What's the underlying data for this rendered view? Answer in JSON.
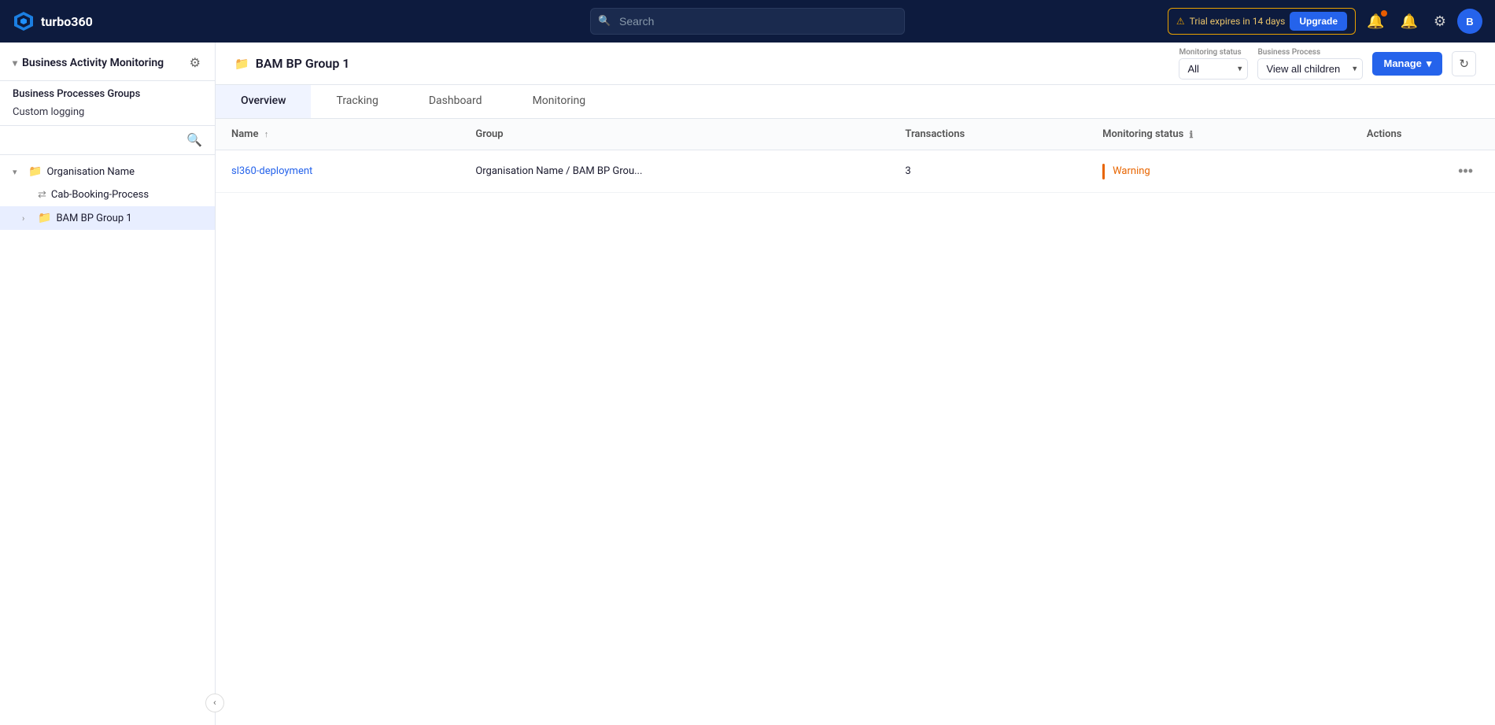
{
  "brand": {
    "name": "turbo360"
  },
  "topnav": {
    "search_placeholder": "Search",
    "trial_text": "Trial expires in 14 days",
    "upgrade_label": "Upgrade",
    "avatar_label": "B"
  },
  "sidebar": {
    "title": "Business Activity Monitoring",
    "section_items": [
      {
        "label": "Business Processes Groups",
        "active": true
      },
      {
        "label": "Custom logging",
        "active": false
      }
    ],
    "tree": [
      {
        "label": "Organisation Name",
        "level": 0,
        "type": "org",
        "expanded": true
      },
      {
        "label": "Cab-Booking-Process",
        "level": 1,
        "type": "process"
      },
      {
        "label": "BAM BP Group 1",
        "level": 1,
        "type": "folder",
        "expanded": true,
        "active": true
      }
    ]
  },
  "page": {
    "title": "BAM BP Group 1",
    "monitoring_status_label": "Monitoring status",
    "monitoring_status_value": "All",
    "business_process_label": "Business Process",
    "business_process_value": "View all children",
    "manage_label": "Manage"
  },
  "tabs": [
    {
      "label": "Overview",
      "active": true
    },
    {
      "label": "Tracking",
      "active": false
    },
    {
      "label": "Dashboard",
      "active": false
    },
    {
      "label": "Monitoring",
      "active": false
    }
  ],
  "table": {
    "columns": [
      {
        "label": "Name",
        "sortable": true
      },
      {
        "label": "Group",
        "sortable": false
      },
      {
        "label": "Transactions",
        "sortable": false
      },
      {
        "label": "Monitoring status",
        "info": true
      },
      {
        "label": "Actions",
        "sortable": false
      }
    ],
    "rows": [
      {
        "name": "sl360-deployment",
        "group": "Organisation Name / BAM BP Grou...",
        "transactions": "3",
        "monitoring_status": "Warning",
        "monitoring_status_type": "warning"
      }
    ]
  }
}
